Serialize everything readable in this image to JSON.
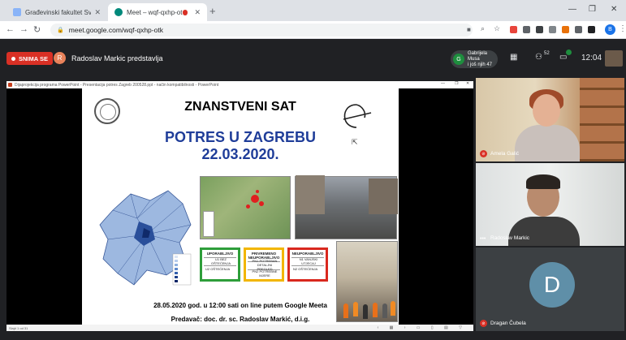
{
  "browser": {
    "tabs": [
      {
        "title": "Građevinski fakultet Sveučilišta u",
        "active": false,
        "favicon_color": "#8ab4f8"
      },
      {
        "title": "Meet – wqf-qxhp-otk",
        "active": true,
        "favicon_color": "#00897b"
      }
    ],
    "url": "meet.google.com/wqf-qxhp-otk",
    "profile_initial": "B"
  },
  "meet": {
    "recording_label": "SNIMA SE",
    "presenter_initial": "R",
    "presenter_text": "Radoslav Markic predstavlja",
    "people_initial": "G",
    "people_line1": "Gabrijela Musa",
    "people_line2": "i još njih 47",
    "participants_count": "52",
    "clock": "12:04"
  },
  "ppt": {
    "window_title": "Dijaprojekcija programa PowerPoint  -  Presentacija potres Zagreb 200528.ppt  -  način kompatibilnosti  -  PowerPoint",
    "status_left": "Slajd 1 od 31"
  },
  "slide": {
    "title": "ZNANSTVENI SAT",
    "subtitle": "POTRES U ZAGREBU",
    "date": "22.03.2020.",
    "status_boxes": [
      {
        "heading": "UPORABLJIVO",
        "color": "#2e9e3a",
        "rows": [
          "U1  BEZ OŠTEĆENJA",
          "U2  OŠTEĆENJA"
        ]
      },
      {
        "heading": "PRIVREMENO NEUPORABLJIVO",
        "color": "#f2b600",
        "rows": [
          "PN1  POTREBAN DETALJNI PREGLED",
          "PN2  POTREBNE MJERE"
        ]
      },
      {
        "heading": "NEUPORABLJIVO",
        "color": "#d9281e",
        "rows": [
          "N1  VANJSKI UTJECAJ",
          "N2  OŠTEĆENJA"
        ]
      }
    ],
    "event_line": "28.05.2020 god.  u 12:00 sati on line putem Google Meeta",
    "lecturer_line": "Predavač: doc. dr. sc. Radoslav Markić, d.i.g."
  },
  "participants": [
    {
      "name": "Amela Galić",
      "muted": true
    },
    {
      "name": "Radoslav Markic",
      "muted": false
    },
    {
      "name": "Dragan Čubela",
      "muted": true,
      "avatar_initial": "D"
    }
  ]
}
